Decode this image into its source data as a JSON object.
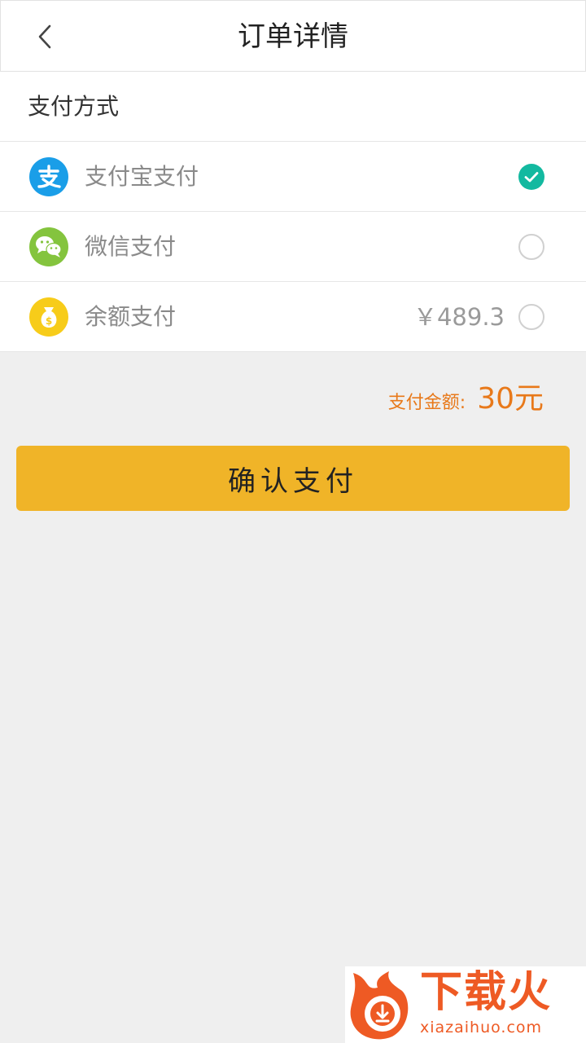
{
  "header": {
    "title": "订单详情",
    "back_icon": "chevron-left-icon"
  },
  "payment": {
    "section_label": "支付方式",
    "methods": [
      {
        "label": "支付宝支付",
        "icon": "alipay-icon",
        "color": "#1a9ee8",
        "selected": true
      },
      {
        "label": "微信支付",
        "icon": "wechat-icon",
        "color": "#84c43e",
        "selected": false
      },
      {
        "label": "余额支付",
        "icon": "money-bag-icon",
        "color": "#f7cc1a",
        "selected": false,
        "balance": "￥489.3"
      }
    ]
  },
  "amount": {
    "label": "支付金额:",
    "value": "30元"
  },
  "confirm_button": {
    "label": "确认支付"
  },
  "watermark": {
    "title": "下载火",
    "site": "xiazaihuo.com"
  },
  "colors": {
    "accent": "#f0b428",
    "amount": "#e8791a",
    "check": "#13b9a0",
    "background": "#efefef"
  }
}
